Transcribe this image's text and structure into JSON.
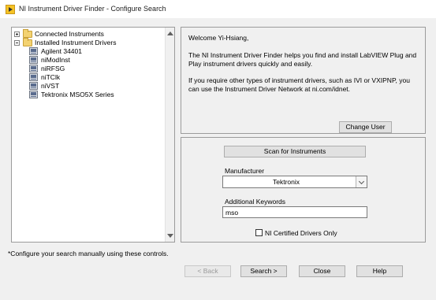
{
  "window": {
    "title": "NI Instrument Driver Finder - Configure Search"
  },
  "tree": {
    "items": [
      {
        "label": "Connected Instruments",
        "type": "folder",
        "level": 0,
        "expanded": false
      },
      {
        "label": "Installed Instrument Drivers",
        "type": "folder",
        "level": 0,
        "expanded": true
      },
      {
        "label": "Agilent 34401",
        "type": "driver",
        "level": 1
      },
      {
        "label": "niModInst",
        "type": "driver",
        "level": 1
      },
      {
        "label": "niRFSG",
        "type": "driver",
        "level": 1
      },
      {
        "label": "niTClk",
        "type": "driver",
        "level": 1
      },
      {
        "label": "niVST",
        "type": "driver",
        "level": 1
      },
      {
        "label": "Tektronix MSO5X Series",
        "type": "driver",
        "level": 1
      }
    ]
  },
  "welcome": {
    "greeting": "Welcome Yi-Hsiang,",
    "paragraph1": "The NI Instrument Driver Finder helps you find and install LabVIEW Plug and Play instrument drivers quickly and easily.",
    "paragraph2": "If you require other types of instrument drivers, such as IVI or VXIPNP, you can use the Instrument Driver Network at ni.com/idnet.",
    "change_user_label": "Change User"
  },
  "search": {
    "scan_label": "Scan for Instruments",
    "manufacturer_label": "Manufacturer",
    "manufacturer_value": "Tektronix",
    "keywords_label": "Additional Keywords",
    "keywords_value": "mso",
    "certified_label": "NI Certified Drivers Only",
    "certified_checked": false
  },
  "footer": {
    "note": "*Configure your search manually using these controls.",
    "back_label": "< Back",
    "search_label": "Search >",
    "close_label": "Close",
    "help_label": "Help"
  }
}
